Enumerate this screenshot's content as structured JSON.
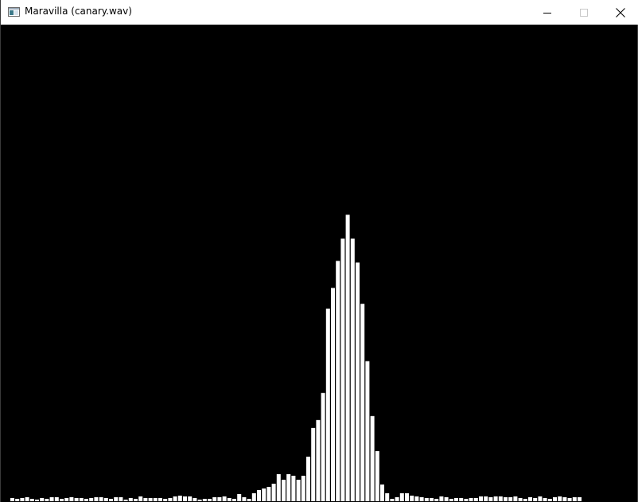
{
  "window": {
    "title": "Maravilla (canary.wav)",
    "controls": {
      "minimize": "minimize-icon",
      "maximize": "maximize-icon",
      "close": "close-icon"
    }
  },
  "colors": {
    "background": "#000000",
    "bars": "#ffffff",
    "titlebar": "#ffffff"
  },
  "chart_data": {
    "type": "bar",
    "values": [
      4,
      3,
      4,
      5,
      3,
      2,
      4,
      3,
      5,
      5,
      3,
      4,
      5,
      4,
      4,
      3,
      4,
      5,
      5,
      4,
      3,
      5,
      5,
      2,
      4,
      3,
      6,
      4,
      4,
      4,
      4,
      3,
      4,
      6,
      7,
      6,
      6,
      4,
      2,
      3,
      3,
      5,
      5,
      6,
      4,
      3,
      9,
      5,
      3,
      10,
      14,
      16,
      18,
      22,
      34,
      27,
      34,
      32,
      27,
      32,
      56,
      92,
      102,
      136,
      242,
      268,
      302,
      330,
      360,
      330,
      300,
      248,
      176,
      107,
      63,
      21,
      10,
      3,
      5,
      10,
      10,
      7,
      6,
      5,
      4,
      4,
      3,
      6,
      5,
      3,
      4,
      4,
      3,
      4,
      4,
      6,
      6,
      5,
      6,
      6,
      5,
      5,
      6,
      4,
      3,
      5,
      4,
      6,
      4,
      3,
      5,
      6,
      5,
      4,
      5,
      5
    ],
    "ylim": [
      0,
      600
    ]
  }
}
